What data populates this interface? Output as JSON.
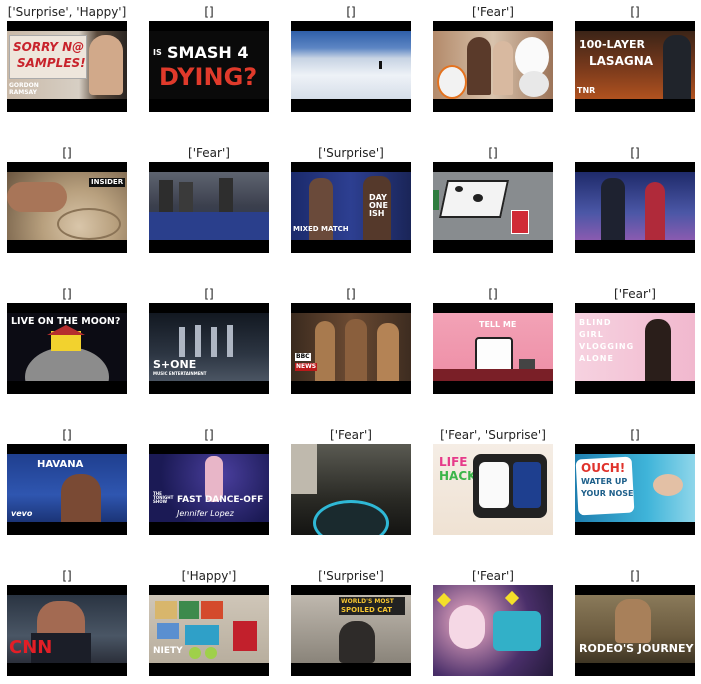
{
  "tiles": [
    {
      "caption": "['Surprise', 'Happy']",
      "overlay": [
        "SORRY N@",
        "SAMPLES!",
        "GORDON",
        "RAMSAY"
      ]
    },
    {
      "caption": "[]",
      "overlay": [
        "IS",
        "SMASH 4",
        "DYING?"
      ]
    },
    {
      "caption": "[]",
      "overlay": []
    },
    {
      "caption": "['Fear']",
      "overlay": []
    },
    {
      "caption": "[]",
      "overlay": [
        "100-LAYER",
        "LASAGNA",
        "TNR"
      ]
    },
    {
      "caption": "[]",
      "overlay": [
        "INSIDER"
      ]
    },
    {
      "caption": "['Fear']",
      "overlay": []
    },
    {
      "caption": "['Surprise']",
      "overlay": [
        "MIXED MATCH",
        "DAY ONE ISH"
      ]
    },
    {
      "caption": "[]",
      "overlay": []
    },
    {
      "caption": "[]",
      "overlay": []
    },
    {
      "caption": "[]",
      "overlay": [
        "LIVE ON THE MOON?"
      ]
    },
    {
      "caption": "[]",
      "overlay": [
        "S+ONE",
        "MUSIC ENTERTAINMENT"
      ]
    },
    {
      "caption": "[]",
      "overlay": [
        "BBC",
        "NEWS"
      ]
    },
    {
      "caption": "[]",
      "overlay": [
        "TELL ME"
      ]
    },
    {
      "caption": "['Fear']",
      "overlay": [
        "BLIND",
        "GIRL",
        "VLOGGING",
        "ALONE"
      ]
    },
    {
      "caption": "[]",
      "overlay": [
        "HAVANA",
        "vevo"
      ]
    },
    {
      "caption": "[]",
      "overlay": [
        "THE TONIGHT SHOW",
        "FAST DANCE-OFF",
        "Jennifer Lopez"
      ]
    },
    {
      "caption": "['Fear']",
      "overlay": []
    },
    {
      "caption": "['Fear', 'Surprise']",
      "overlay": [
        "LIFE",
        "HACKS"
      ]
    },
    {
      "caption": "[]",
      "overlay": [
        "OUCH!",
        "WATER UP",
        "YOUR NOSE"
      ]
    },
    {
      "caption": "[]",
      "overlay": [
        "CNN"
      ]
    },
    {
      "caption": "['Happy']",
      "overlay": [
        "NIETY"
      ]
    },
    {
      "caption": "['Surprise']",
      "overlay": [
        "WORLD'S MOST",
        "SPOILED CAT"
      ]
    },
    {
      "caption": "['Fear']",
      "overlay": []
    },
    {
      "caption": "[]",
      "overlay": [
        "RODEO'S JOURNEY"
      ]
    }
  ]
}
